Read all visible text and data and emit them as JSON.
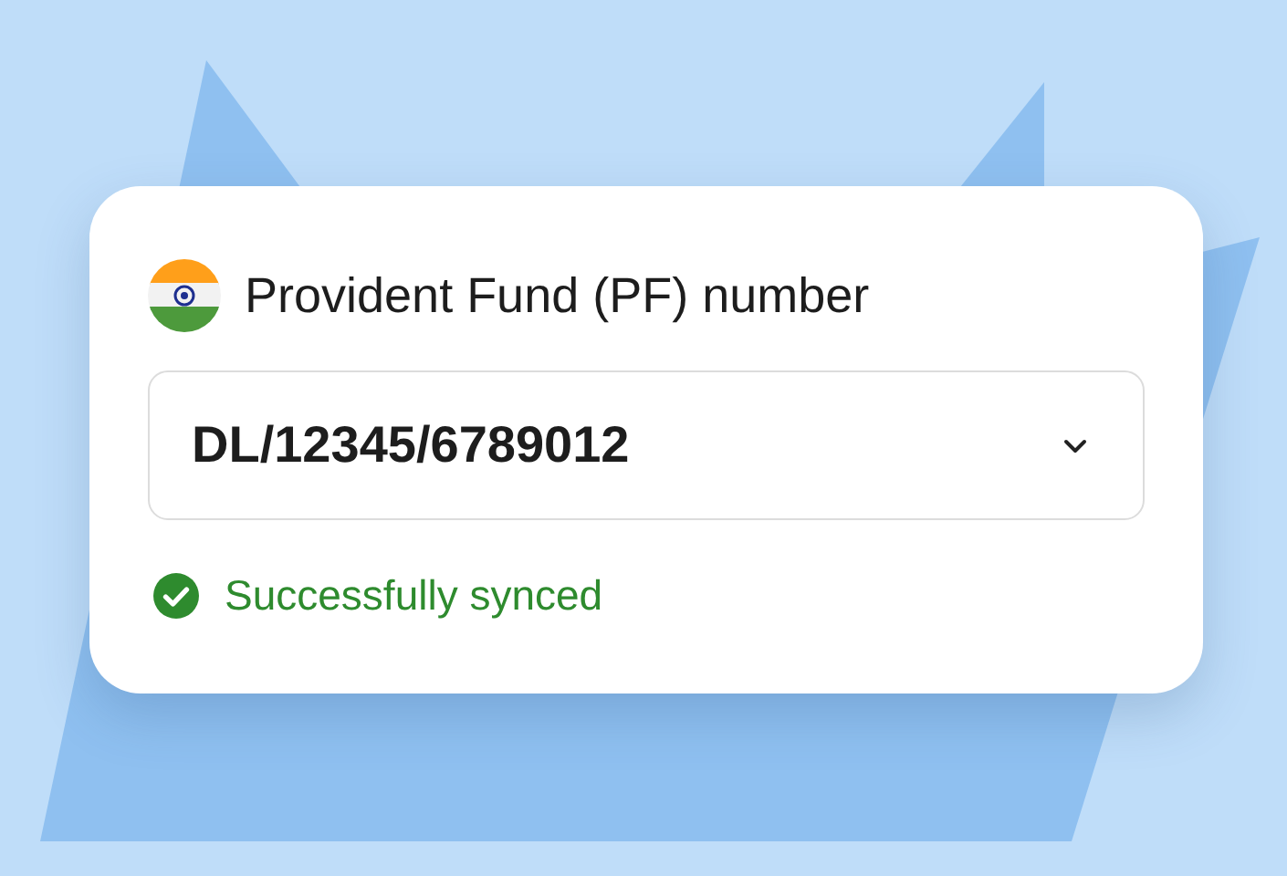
{
  "field": {
    "label": "Provident Fund (PF) number",
    "value": "DL/12345/6789012"
  },
  "status": {
    "kind": "success",
    "text": "Successfully synced"
  }
}
